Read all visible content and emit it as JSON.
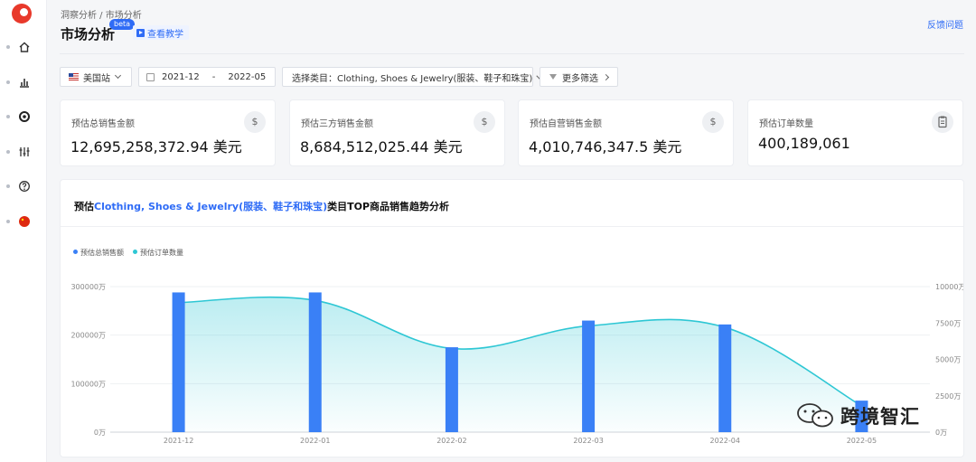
{
  "header": {
    "breadcrumb": "洞察分析 / 市场分析",
    "title": "市场分析",
    "beta": "beta",
    "tutorial": "查看教学",
    "feedback": "反馈问题"
  },
  "filters": {
    "site": "美国站",
    "date_start": "2021-12",
    "date_sep": "-",
    "date_end": "2022-05",
    "category": "选择类目：Clothing, Shoes & Jewelry(服装、鞋子和珠宝)",
    "more": "更多筛选"
  },
  "stats": [
    {
      "label": "预估总销售金额",
      "value": "12,695,258,372.94 美元",
      "icon": "$"
    },
    {
      "label": "预估三方销售金额",
      "value": "8,684,512,025.44 美元",
      "icon": "$"
    },
    {
      "label": "预估自营销售金额",
      "value": "4,010,746,347.5 美元",
      "icon": "$"
    },
    {
      "label": "预估订单数量",
      "value": "400,189,061",
      "icon": "clipboard-icon"
    }
  ],
  "chart_title": {
    "prefix": "预估",
    "category": "Clothing, Shoes & Jewelry(服装、鞋子和珠宝)",
    "suffix": "类目TOP商品销售趋势分析"
  },
  "colors": {
    "bar": "#3a80f6",
    "line": "#2ec7d4",
    "accent": "#2f6cf6"
  },
  "chart_data": {
    "type": "bar",
    "categories": [
      "2021-12",
      "2022-01",
      "2022-02",
      "2022-03",
      "2022-04",
      "2022-05"
    ],
    "series": [
      {
        "name": "预估总销售额",
        "type": "bar",
        "axis": "left",
        "values": [
          288000,
          288000,
          175000,
          230000,
          222000,
          65000
        ]
      },
      {
        "name": "预估订单数量",
        "type": "area",
        "axis": "right",
        "values": [
          8900,
          9050,
          5750,
          7300,
          7200,
          1800
        ]
      }
    ],
    "y_left": {
      "min": 0,
      "max": 300000,
      "ticks": [
        "0万",
        "100000万",
        "200000万",
        "300000万"
      ]
    },
    "y_right": {
      "min": 0,
      "max": 10000,
      "ticks": [
        "0万",
        "2500万",
        "5000万",
        "7500万",
        "10000万"
      ]
    },
    "grid": true,
    "legend": "top-left"
  },
  "watermark": "跨境智汇"
}
